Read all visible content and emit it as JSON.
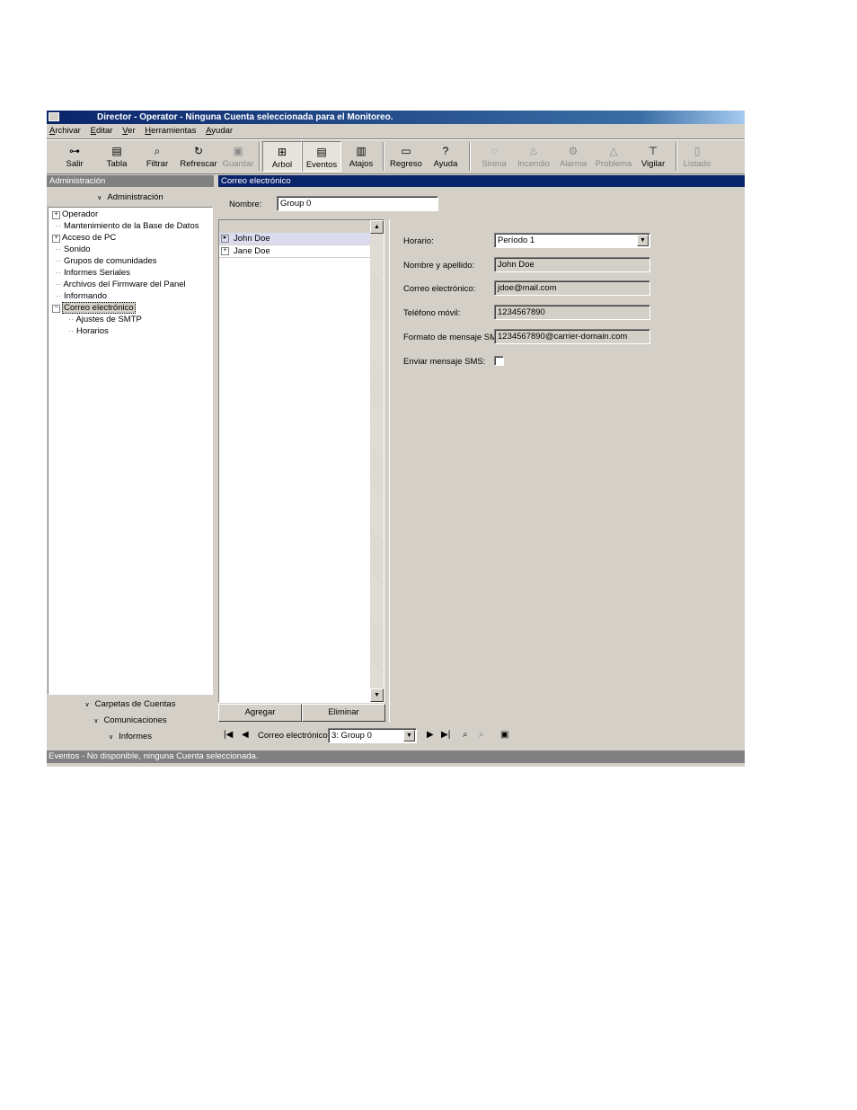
{
  "window": {
    "title": "Director - Operator - Ninguna Cuenta seleccionada para el Monitoreo."
  },
  "menu": [
    "Archivar",
    "Editar",
    "Ver",
    "Herramientas",
    "Ayudar"
  ],
  "toolbar": {
    "salir": "Salir",
    "tabla": "Tabla",
    "filtrar": "Filtrar",
    "refrescar": "Refrescar",
    "guardar": "Guardar",
    "arbol": "Arbol",
    "eventos": "Eventos",
    "atajos": "Atajos",
    "regreso": "Regreso",
    "ayuda": "Ayuda",
    "sirena": "Sirena",
    "incendio": "Incendio",
    "alarma": "Alarma",
    "problema": "Problema",
    "vigilar": "Vigilar",
    "listado": "Listado"
  },
  "left_panel": {
    "header": "Administración",
    "group_title": "Administración",
    "tree": [
      "Operador",
      "Mantenimiento de la Base de Datos",
      "Acceso de PC",
      "Sonido",
      "Grupos de comunidades",
      "Informes Seriales",
      "Archivos del Firmware del Panel",
      "Informando",
      "Correo electrónico",
      "Ajustes de SMTP",
      "Horarios"
    ],
    "lower_groups": [
      "Carpetas de Cuentas",
      "Comunicaciones",
      "Informes"
    ]
  },
  "main": {
    "header": "Correo electrónico",
    "nombre_label": "Nombre:",
    "nombre_value": "Group 0",
    "list": [
      "John Doe",
      "Jane Doe"
    ],
    "agregar": "Agregar",
    "eliminar": "Eliminar",
    "details": {
      "horario_label": "Horario:",
      "horario_value": "Período 1",
      "nombre_label": "Nombre y apellido:",
      "nombre_value": "John Doe",
      "correo_label": "Correo electrónico:",
      "correo_value": "jdoe@mail.com",
      "telefono_label": "Teléfono móvil:",
      "telefono_value": "1234567890",
      "formato_label": "Formato de mensaje SMS:",
      "formato_value": "1234567890@carrier-domain.com",
      "enviar_label": "Enviar mensaje SMS:",
      "enviar_checked": false
    },
    "navigator": {
      "label": "Correo electrónico:",
      "value": "3: Group 0"
    }
  },
  "status": "Eventos - No disponible, ninguna Cuenta seleccionada."
}
